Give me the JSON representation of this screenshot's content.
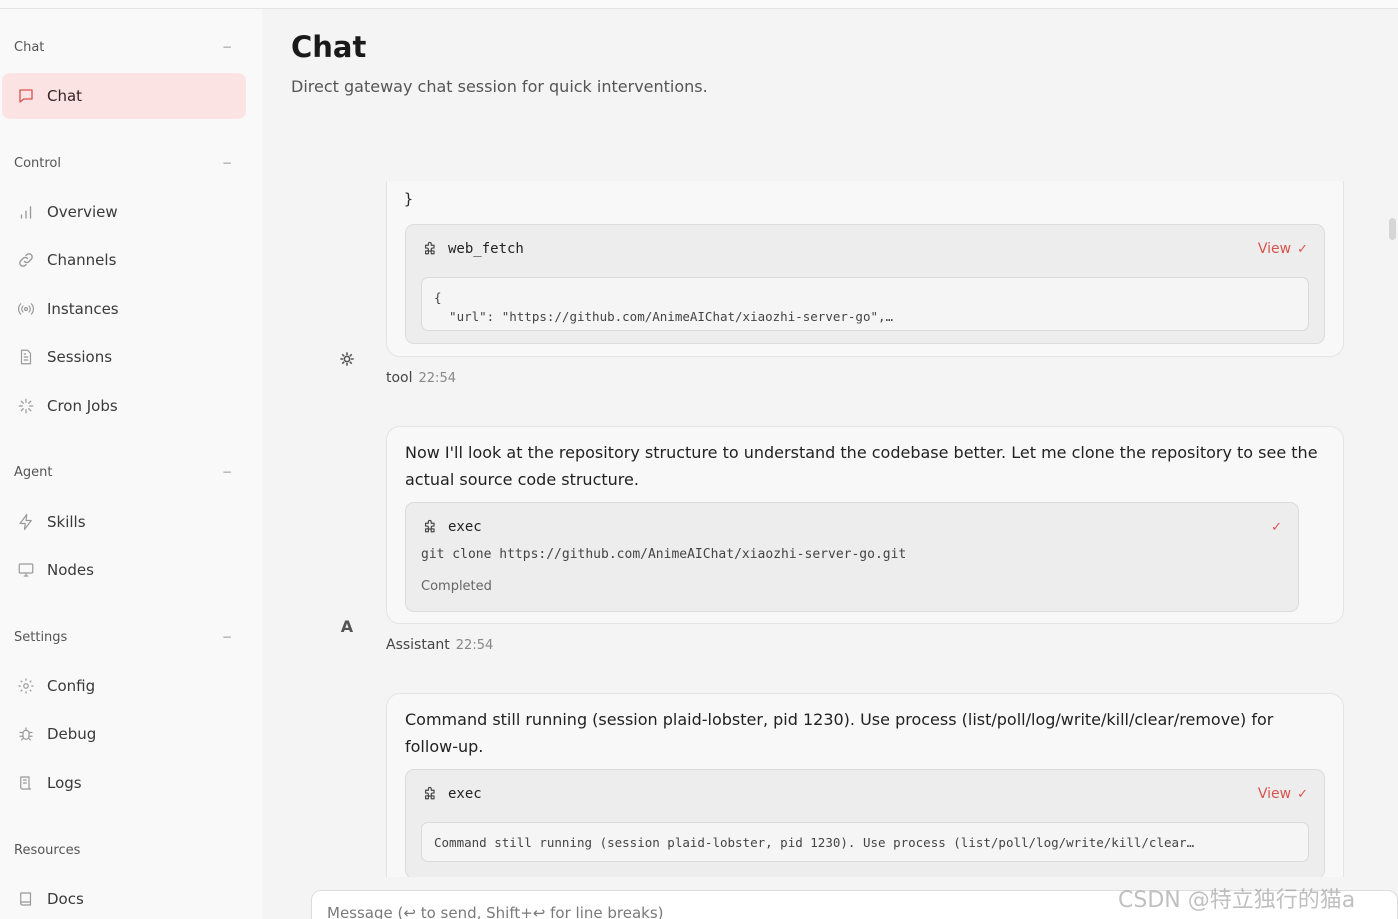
{
  "sidebar": {
    "groups": [
      {
        "label": "Chat",
        "collapse": "−"
      },
      {
        "label": "Control",
        "collapse": "−"
      },
      {
        "label": "Agent",
        "collapse": "−"
      },
      {
        "label": "Settings",
        "collapse": "−"
      },
      {
        "label": "Resources",
        "collapse": ""
      }
    ],
    "items": [
      {
        "label": "Chat",
        "icon": "message-square-icon",
        "active": true
      },
      {
        "label": "Overview",
        "icon": "bar-chart-icon"
      },
      {
        "label": "Channels",
        "icon": "link-icon"
      },
      {
        "label": "Instances",
        "icon": "radio-icon"
      },
      {
        "label": "Sessions",
        "icon": "file-text-icon"
      },
      {
        "label": "Cron Jobs",
        "icon": "loader-icon"
      },
      {
        "label": "Skills",
        "icon": "zap-icon"
      },
      {
        "label": "Nodes",
        "icon": "monitor-icon"
      },
      {
        "label": "Config",
        "icon": "gear-icon"
      },
      {
        "label": "Debug",
        "icon": "bug-icon"
      },
      {
        "label": "Logs",
        "icon": "scroll-icon"
      },
      {
        "label": "Docs",
        "icon": "book-icon"
      }
    ]
  },
  "header": {
    "title": "Chat",
    "subtitle": "Direct gateway chat session for quick interventions."
  },
  "messages": [
    {
      "partial_text": "}",
      "tool": {
        "name": "web_fetch",
        "action": "View",
        "code": "{\n  \"url\": \"https://github.com/AnimeAIChat/xiaozhi-server-go\",…"
      },
      "role": "tool",
      "time": "22:54",
      "avatar": "gear-icon"
    },
    {
      "text": "Now I'll look at the repository structure to understand the codebase better. Let me clone the repository to see the actual source code structure.",
      "tool": {
        "name": "exec",
        "command": "git clone https://github.com/AnimeAIChat/xiaozhi-server-go.git",
        "status": "Completed"
      },
      "role": "Assistant",
      "time": "22:54",
      "avatar": "A"
    },
    {
      "text": "Command still running (session plaid-lobster, pid 1230). Use process (list/poll/log/write/kill/clear/remove) for follow-up.",
      "tool": {
        "name": "exec",
        "action": "View",
        "code": "Command still running (session plaid-lobster, pid 1230). Use process (list/poll/log/write/kill/clear…"
      }
    }
  ],
  "composer": {
    "placeholder": "Message (↩ to send, Shift+↩ for line breaks)"
  },
  "watermark": "CSDN @特立独行的猫a",
  "colors": {
    "accent": "#d9534f",
    "active_bg": "#fbe3e3",
    "sidebar_bg": "#f9f9f9",
    "main_bg": "#f4f4f4"
  }
}
